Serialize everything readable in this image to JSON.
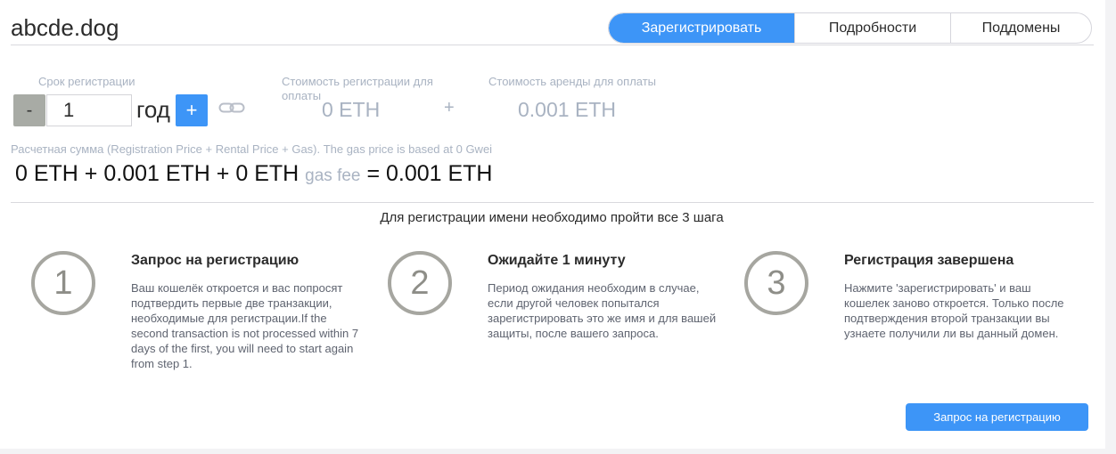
{
  "header": {
    "domain": "abcde.dog",
    "tabs": [
      {
        "label": "Зарегистрировать",
        "active": true
      },
      {
        "label": "Подробности",
        "active": false
      },
      {
        "label": "Поддомены",
        "active": false
      }
    ]
  },
  "registration": {
    "term_label": "Срок регистрации",
    "minus_label": "-",
    "years_value": "1",
    "years_unit": "год",
    "plus_label": "+",
    "cost_label": "Стоимость регистрации для оплаты",
    "cost_value": "0 ETH",
    "plus_sign": "+",
    "rent_label": "Стоимость аренды для оплаты",
    "rent_value": "0.001 ETH"
  },
  "estimate": {
    "label": "Расчетная сумма (Registration Price + Rental Price + Gas). The gas price is based at 0 Gwei",
    "part1": "0 ETH + 0.001 ETH + 0 ETH",
    "gas_fee": "gas fee",
    "result": "= 0.001 ETH"
  },
  "steps": {
    "title": "Для регистрации имени необходимо пройти все 3 шага",
    "items": [
      {
        "number": "1",
        "title": "Запрос на регистрацию",
        "text": "Ваш кошелёк откроется и вас попросят подтвердить первые две транзакции, необходимые для регистрации.If the second transaction is not processed within 7 days of the first, you will need to start again from step 1."
      },
      {
        "number": "2",
        "title": "Ожидайте 1 минуту",
        "text": "Период ожидания необходим в случае, если другой человек попытался зарегистрировать это же имя и для вашей защиты, после вашего запроса."
      },
      {
        "number": "3",
        "title": "Регистрация завершена",
        "text": "Нажмите 'зарегистрировать' и ваш кошелек заново откроется. Только после подтверждения второй транзакции вы узнаете получили ли вы данный домен."
      }
    ]
  },
  "action": {
    "submit_label": "Запрос на регистрацию"
  },
  "colors": {
    "accent": "#3d95f7",
    "muted_text": "#a9b3c2",
    "step_circle": "#a6a6a0"
  },
  "icons": {
    "link": "link-icon"
  }
}
